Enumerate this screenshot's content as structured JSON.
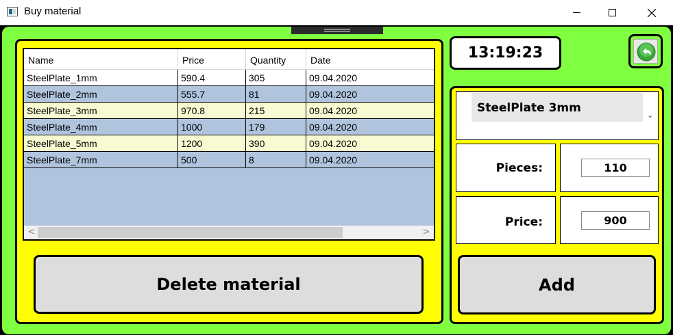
{
  "window": {
    "title": "Buy material",
    "controls": {
      "minimize": "minimize",
      "maximize": "maximize",
      "close": "close"
    }
  },
  "grid": {
    "columns": [
      "Name",
      "Price",
      "Quantity",
      "Date"
    ],
    "rows": [
      {
        "name": "SteelPlate_1mm",
        "price": "590.4",
        "quantity": "305",
        "date": "09.04.2020",
        "bg": "#ffffff"
      },
      {
        "name": "SteelPlate_2mm",
        "price": "555.7",
        "quantity": "81",
        "date": "09.04.2020",
        "bg": "#b0c4de"
      },
      {
        "name": "SteelPlate_3mm",
        "price": "970.8",
        "quantity": "215",
        "date": "09.04.2020",
        "bg": "#fafad2"
      },
      {
        "name": "SteelPlate_4mm",
        "price": "1000",
        "quantity": "179",
        "date": "09.04.2020",
        "bg": "#b0c4de"
      },
      {
        "name": "SteelPlate_5mm",
        "price": "1200",
        "quantity": "390",
        "date": "09.04.2020",
        "bg": "#fafad2"
      },
      {
        "name": "SteelPlate_7mm",
        "price": "500",
        "quantity": "8",
        "date": "09.04.2020",
        "bg": "#b0c4de"
      }
    ],
    "scroll_left_glyph": "<",
    "scroll_right_glyph": ">"
  },
  "buttons": {
    "delete_label": "Delete material",
    "add_label": "Add"
  },
  "clock": {
    "time": "13:19:23"
  },
  "back_button": {
    "icon": "back-arrow-icon"
  },
  "form": {
    "material_selected": "SteelPlate 3mm",
    "chevron_glyph": "⌄",
    "pieces_label": "Pieces:",
    "pieces_value": "110",
    "price_label": "Price:",
    "price_value": "900"
  },
  "colors": {
    "background": "#80ff40",
    "panel": "#ffff00",
    "row_blue": "#b0c4de",
    "row_yellow": "#fafad2",
    "button": "#dddddd"
  }
}
